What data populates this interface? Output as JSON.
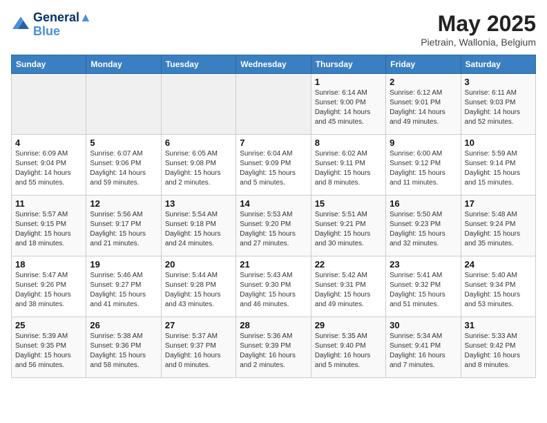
{
  "logo": {
    "line1": "General",
    "line2": "Blue"
  },
  "title": "May 2025",
  "subtitle": "Pietrain, Wallonia, Belgium",
  "days_header": [
    "Sunday",
    "Monday",
    "Tuesday",
    "Wednesday",
    "Thursday",
    "Friday",
    "Saturday"
  ],
  "weeks": [
    [
      {
        "day": "",
        "info": ""
      },
      {
        "day": "",
        "info": ""
      },
      {
        "day": "",
        "info": ""
      },
      {
        "day": "",
        "info": ""
      },
      {
        "day": "1",
        "info": "Sunrise: 6:14 AM\nSunset: 9:00 PM\nDaylight: 14 hours\nand 45 minutes."
      },
      {
        "day": "2",
        "info": "Sunrise: 6:12 AM\nSunset: 9:01 PM\nDaylight: 14 hours\nand 49 minutes."
      },
      {
        "day": "3",
        "info": "Sunrise: 6:11 AM\nSunset: 9:03 PM\nDaylight: 14 hours\nand 52 minutes."
      }
    ],
    [
      {
        "day": "4",
        "info": "Sunrise: 6:09 AM\nSunset: 9:04 PM\nDaylight: 14 hours\nand 55 minutes."
      },
      {
        "day": "5",
        "info": "Sunrise: 6:07 AM\nSunset: 9:06 PM\nDaylight: 14 hours\nand 59 minutes."
      },
      {
        "day": "6",
        "info": "Sunrise: 6:05 AM\nSunset: 9:08 PM\nDaylight: 15 hours\nand 2 minutes."
      },
      {
        "day": "7",
        "info": "Sunrise: 6:04 AM\nSunset: 9:09 PM\nDaylight: 15 hours\nand 5 minutes."
      },
      {
        "day": "8",
        "info": "Sunrise: 6:02 AM\nSunset: 9:11 PM\nDaylight: 15 hours\nand 8 minutes."
      },
      {
        "day": "9",
        "info": "Sunrise: 6:00 AM\nSunset: 9:12 PM\nDaylight: 15 hours\nand 11 minutes."
      },
      {
        "day": "10",
        "info": "Sunrise: 5:59 AM\nSunset: 9:14 PM\nDaylight: 15 hours\nand 15 minutes."
      }
    ],
    [
      {
        "day": "11",
        "info": "Sunrise: 5:57 AM\nSunset: 9:15 PM\nDaylight: 15 hours\nand 18 minutes."
      },
      {
        "day": "12",
        "info": "Sunrise: 5:56 AM\nSunset: 9:17 PM\nDaylight: 15 hours\nand 21 minutes."
      },
      {
        "day": "13",
        "info": "Sunrise: 5:54 AM\nSunset: 9:18 PM\nDaylight: 15 hours\nand 24 minutes."
      },
      {
        "day": "14",
        "info": "Sunrise: 5:53 AM\nSunset: 9:20 PM\nDaylight: 15 hours\nand 27 minutes."
      },
      {
        "day": "15",
        "info": "Sunrise: 5:51 AM\nSunset: 9:21 PM\nDaylight: 15 hours\nand 30 minutes."
      },
      {
        "day": "16",
        "info": "Sunrise: 5:50 AM\nSunset: 9:23 PM\nDaylight: 15 hours\nand 32 minutes."
      },
      {
        "day": "17",
        "info": "Sunrise: 5:48 AM\nSunset: 9:24 PM\nDaylight: 15 hours\nand 35 minutes."
      }
    ],
    [
      {
        "day": "18",
        "info": "Sunrise: 5:47 AM\nSunset: 9:26 PM\nDaylight: 15 hours\nand 38 minutes."
      },
      {
        "day": "19",
        "info": "Sunrise: 5:46 AM\nSunset: 9:27 PM\nDaylight: 15 hours\nand 41 minutes."
      },
      {
        "day": "20",
        "info": "Sunrise: 5:44 AM\nSunset: 9:28 PM\nDaylight: 15 hours\nand 43 minutes."
      },
      {
        "day": "21",
        "info": "Sunrise: 5:43 AM\nSunset: 9:30 PM\nDaylight: 15 hours\nand 46 minutes."
      },
      {
        "day": "22",
        "info": "Sunrise: 5:42 AM\nSunset: 9:31 PM\nDaylight: 15 hours\nand 49 minutes."
      },
      {
        "day": "23",
        "info": "Sunrise: 5:41 AM\nSunset: 9:32 PM\nDaylight: 15 hours\nand 51 minutes."
      },
      {
        "day": "24",
        "info": "Sunrise: 5:40 AM\nSunset: 9:34 PM\nDaylight: 15 hours\nand 53 minutes."
      }
    ],
    [
      {
        "day": "25",
        "info": "Sunrise: 5:39 AM\nSunset: 9:35 PM\nDaylight: 15 hours\nand 56 minutes."
      },
      {
        "day": "26",
        "info": "Sunrise: 5:38 AM\nSunset: 9:36 PM\nDaylight: 15 hours\nand 58 minutes."
      },
      {
        "day": "27",
        "info": "Sunrise: 5:37 AM\nSunset: 9:37 PM\nDaylight: 16 hours\nand 0 minutes."
      },
      {
        "day": "28",
        "info": "Sunrise: 5:36 AM\nSunset: 9:39 PM\nDaylight: 16 hours\nand 2 minutes."
      },
      {
        "day": "29",
        "info": "Sunrise: 5:35 AM\nSunset: 9:40 PM\nDaylight: 16 hours\nand 5 minutes."
      },
      {
        "day": "30",
        "info": "Sunrise: 5:34 AM\nSunset: 9:41 PM\nDaylight: 16 hours\nand 7 minutes."
      },
      {
        "day": "31",
        "info": "Sunrise: 5:33 AM\nSunset: 9:42 PM\nDaylight: 16 hours\nand 8 minutes."
      }
    ]
  ]
}
